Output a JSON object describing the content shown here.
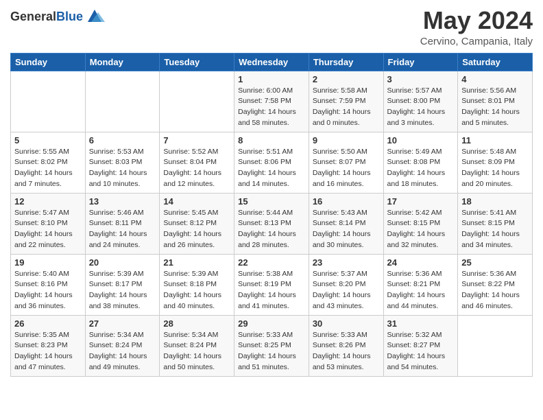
{
  "header": {
    "logo_general": "General",
    "logo_blue": "Blue",
    "month": "May 2024",
    "location": "Cervino, Campania, Italy"
  },
  "weekdays": [
    "Sunday",
    "Monday",
    "Tuesday",
    "Wednesday",
    "Thursday",
    "Friday",
    "Saturday"
  ],
  "weeks": [
    [
      {
        "day": "",
        "sunrise": "",
        "sunset": "",
        "daylight": ""
      },
      {
        "day": "",
        "sunrise": "",
        "sunset": "",
        "daylight": ""
      },
      {
        "day": "",
        "sunrise": "",
        "sunset": "",
        "daylight": ""
      },
      {
        "day": "1",
        "sunrise": "Sunrise: 6:00 AM",
        "sunset": "Sunset: 7:58 PM",
        "daylight": "Daylight: 14 hours and 58 minutes."
      },
      {
        "day": "2",
        "sunrise": "Sunrise: 5:58 AM",
        "sunset": "Sunset: 7:59 PM",
        "daylight": "Daylight: 14 hours and 0 minutes."
      },
      {
        "day": "3",
        "sunrise": "Sunrise: 5:57 AM",
        "sunset": "Sunset: 8:00 PM",
        "daylight": "Daylight: 14 hours and 3 minutes."
      },
      {
        "day": "4",
        "sunrise": "Sunrise: 5:56 AM",
        "sunset": "Sunset: 8:01 PM",
        "daylight": "Daylight: 14 hours and 5 minutes."
      }
    ],
    [
      {
        "day": "5",
        "sunrise": "Sunrise: 5:55 AM",
        "sunset": "Sunset: 8:02 PM",
        "daylight": "Daylight: 14 hours and 7 minutes."
      },
      {
        "day": "6",
        "sunrise": "Sunrise: 5:53 AM",
        "sunset": "Sunset: 8:03 PM",
        "daylight": "Daylight: 14 hours and 10 minutes."
      },
      {
        "day": "7",
        "sunrise": "Sunrise: 5:52 AM",
        "sunset": "Sunset: 8:04 PM",
        "daylight": "Daylight: 14 hours and 12 minutes."
      },
      {
        "day": "8",
        "sunrise": "Sunrise: 5:51 AM",
        "sunset": "Sunset: 8:06 PM",
        "daylight": "Daylight: 14 hours and 14 minutes."
      },
      {
        "day": "9",
        "sunrise": "Sunrise: 5:50 AM",
        "sunset": "Sunset: 8:07 PM",
        "daylight": "Daylight: 14 hours and 16 minutes."
      },
      {
        "day": "10",
        "sunrise": "Sunrise: 5:49 AM",
        "sunset": "Sunset: 8:08 PM",
        "daylight": "Daylight: 14 hours and 18 minutes."
      },
      {
        "day": "11",
        "sunrise": "Sunrise: 5:48 AM",
        "sunset": "Sunset: 8:09 PM",
        "daylight": "Daylight: 14 hours and 20 minutes."
      }
    ],
    [
      {
        "day": "12",
        "sunrise": "Sunrise: 5:47 AM",
        "sunset": "Sunset: 8:10 PM",
        "daylight": "Daylight: 14 hours and 22 minutes."
      },
      {
        "day": "13",
        "sunrise": "Sunrise: 5:46 AM",
        "sunset": "Sunset: 8:11 PM",
        "daylight": "Daylight: 14 hours and 24 minutes."
      },
      {
        "day": "14",
        "sunrise": "Sunrise: 5:45 AM",
        "sunset": "Sunset: 8:12 PM",
        "daylight": "Daylight: 14 hours and 26 minutes."
      },
      {
        "day": "15",
        "sunrise": "Sunrise: 5:44 AM",
        "sunset": "Sunset: 8:13 PM",
        "daylight": "Daylight: 14 hours and 28 minutes."
      },
      {
        "day": "16",
        "sunrise": "Sunrise: 5:43 AM",
        "sunset": "Sunset: 8:14 PM",
        "daylight": "Daylight: 14 hours and 30 minutes."
      },
      {
        "day": "17",
        "sunrise": "Sunrise: 5:42 AM",
        "sunset": "Sunset: 8:15 PM",
        "daylight": "Daylight: 14 hours and 32 minutes."
      },
      {
        "day": "18",
        "sunrise": "Sunrise: 5:41 AM",
        "sunset": "Sunset: 8:15 PM",
        "daylight": "Daylight: 14 hours and 34 minutes."
      }
    ],
    [
      {
        "day": "19",
        "sunrise": "Sunrise: 5:40 AM",
        "sunset": "Sunset: 8:16 PM",
        "daylight": "Daylight: 14 hours and 36 minutes."
      },
      {
        "day": "20",
        "sunrise": "Sunrise: 5:39 AM",
        "sunset": "Sunset: 8:17 PM",
        "daylight": "Daylight: 14 hours and 38 minutes."
      },
      {
        "day": "21",
        "sunrise": "Sunrise: 5:39 AM",
        "sunset": "Sunset: 8:18 PM",
        "daylight": "Daylight: 14 hours and 40 minutes."
      },
      {
        "day": "22",
        "sunrise": "Sunrise: 5:38 AM",
        "sunset": "Sunset: 8:19 PM",
        "daylight": "Daylight: 14 hours and 41 minutes."
      },
      {
        "day": "23",
        "sunrise": "Sunrise: 5:37 AM",
        "sunset": "Sunset: 8:20 PM",
        "daylight": "Daylight: 14 hours and 43 minutes."
      },
      {
        "day": "24",
        "sunrise": "Sunrise: 5:36 AM",
        "sunset": "Sunset: 8:21 PM",
        "daylight": "Daylight: 14 hours and 44 minutes."
      },
      {
        "day": "25",
        "sunrise": "Sunrise: 5:36 AM",
        "sunset": "Sunset: 8:22 PM",
        "daylight": "Daylight: 14 hours and 46 minutes."
      }
    ],
    [
      {
        "day": "26",
        "sunrise": "Sunrise: 5:35 AM",
        "sunset": "Sunset: 8:23 PM",
        "daylight": "Daylight: 14 hours and 47 minutes."
      },
      {
        "day": "27",
        "sunrise": "Sunrise: 5:34 AM",
        "sunset": "Sunset: 8:24 PM",
        "daylight": "Daylight: 14 hours and 49 minutes."
      },
      {
        "day": "28",
        "sunrise": "Sunrise: 5:34 AM",
        "sunset": "Sunset: 8:24 PM",
        "daylight": "Daylight: 14 hours and 50 minutes."
      },
      {
        "day": "29",
        "sunrise": "Sunrise: 5:33 AM",
        "sunset": "Sunset: 8:25 PM",
        "daylight": "Daylight: 14 hours and 51 minutes."
      },
      {
        "day": "30",
        "sunrise": "Sunrise: 5:33 AM",
        "sunset": "Sunset: 8:26 PM",
        "daylight": "Daylight: 14 hours and 53 minutes."
      },
      {
        "day": "31",
        "sunrise": "Sunrise: 5:32 AM",
        "sunset": "Sunset: 8:27 PM",
        "daylight": "Daylight: 14 hours and 54 minutes."
      },
      {
        "day": "",
        "sunrise": "",
        "sunset": "",
        "daylight": ""
      }
    ]
  ]
}
